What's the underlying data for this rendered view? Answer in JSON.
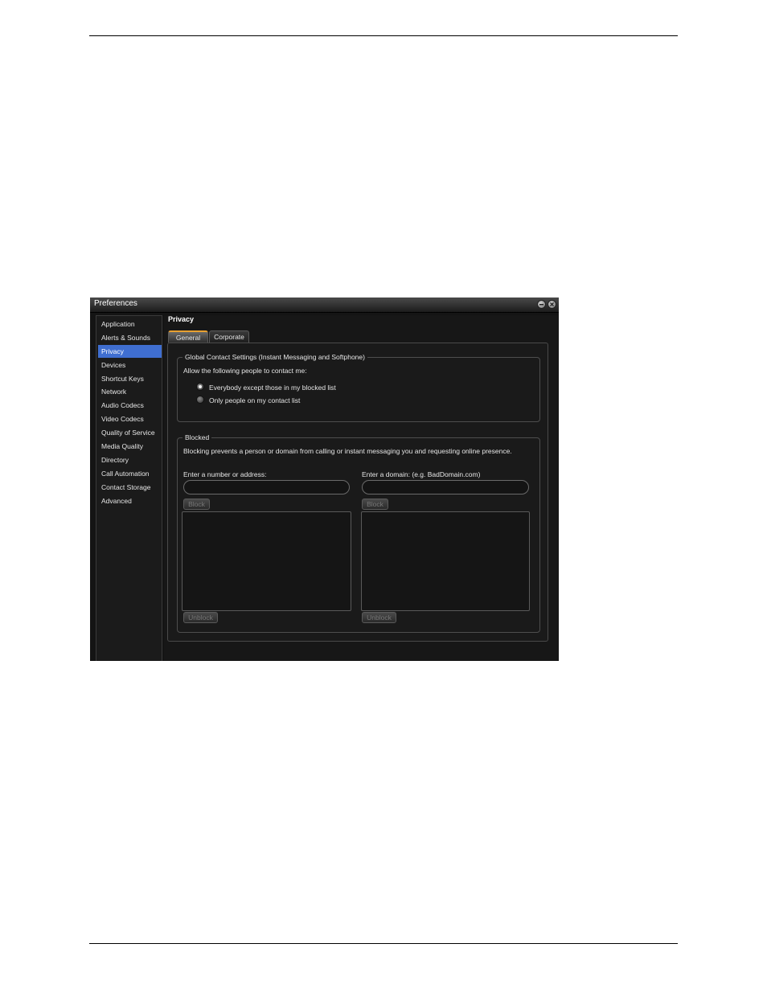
{
  "window": {
    "title": "Preferences"
  },
  "sidebar": {
    "items": [
      {
        "label": "Application"
      },
      {
        "label": "Alerts & Sounds"
      },
      {
        "label": "Privacy",
        "active": true
      },
      {
        "label": "Devices"
      },
      {
        "label": "Shortcut Keys"
      },
      {
        "label": "Network"
      },
      {
        "label": "Audio Codecs"
      },
      {
        "label": "Video Codecs"
      },
      {
        "label": "Quality of Service"
      },
      {
        "label": "Media Quality"
      },
      {
        "label": "Directory"
      },
      {
        "label": "Call Automation"
      },
      {
        "label": "Contact Storage"
      },
      {
        "label": "Advanced"
      }
    ]
  },
  "main": {
    "section_title": "Privacy",
    "tabs": [
      {
        "label": "General",
        "active": true
      },
      {
        "label": "Corporate"
      }
    ],
    "global": {
      "legend": "Global Contact Settings (Instant Messaging and Softphone)",
      "prompt": "Allow the following people to contact me:",
      "options": [
        {
          "label": "Everybody except those in my blocked list",
          "checked": true
        },
        {
          "label": "Only people on my contact list",
          "checked": false
        }
      ]
    },
    "blocked": {
      "legend": "Blocked",
      "description": "Blocking prevents a person or domain from calling or instant messaging you and requesting online presence.",
      "address_label": "Enter a number or address:",
      "domain_label": "Enter a domain: (e.g. BadDomain.com)",
      "address_value": "",
      "domain_value": "",
      "block_label": "Block",
      "unblock_label": "Unblock"
    }
  },
  "colors": {
    "accent": "#3f6ed0",
    "tab_highlight": "#e8a030",
    "window_bg": "#141414"
  }
}
